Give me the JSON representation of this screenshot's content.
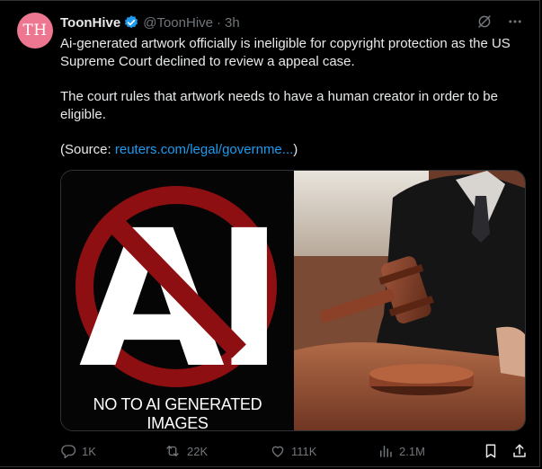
{
  "author": {
    "avatar_text": "TH",
    "avatar_color": "#ed7790",
    "name": "ToonHive",
    "handle": "@ToonHive",
    "separator": "·",
    "time": "3h"
  },
  "tweet": {
    "paragraph1": "Ai-generated artwork officially is ineligible for copyright protection as the US Supreme Court declined to review a appeal case.",
    "paragraph2": "The court rules that artwork needs to have a human creator in order to be eligible.",
    "source_prefix": "(Source: ",
    "source_link": "reuters.com/legal/governme...",
    "source_suffix": ")"
  },
  "media": {
    "left_caption": "NO TO AI GENERATED IMAGES",
    "left_logo_text": "AI"
  },
  "actions": {
    "reply_count": "1K",
    "retweet_count": "22K",
    "like_count": "111K",
    "views_count": "2.1M"
  },
  "colors": {
    "link": "#1d9bf0",
    "muted": "#71767b",
    "verified": "#1d9bf0",
    "prohibition_red": "#8e0f12"
  }
}
